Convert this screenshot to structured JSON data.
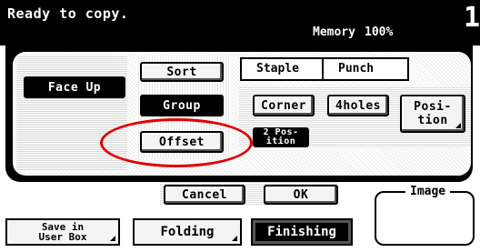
{
  "header": {
    "status": "Ready to copy.",
    "memory_label": "Memory",
    "memory_value": "100%",
    "page_indicator": "1"
  },
  "finishing": {
    "face_up": "Face Up",
    "sort": "Sort",
    "group": "Group",
    "offset": "Offset",
    "staple": "Staple",
    "punch": "Punch",
    "corner": "Corner",
    "holes": "4holes",
    "position_line1": "Posi-",
    "position_line2": "tion",
    "two_position_line1": "2 Pos-",
    "two_position_line2": "ition"
  },
  "actions": {
    "cancel": "Cancel",
    "ok": "OK"
  },
  "image_area": {
    "label": "Image"
  },
  "tabs": {
    "save_line1": "Save in",
    "save_line2": "User Box",
    "folding": "Folding",
    "finishing": "Finishing"
  },
  "colors": {
    "annotation": "#e00000"
  }
}
